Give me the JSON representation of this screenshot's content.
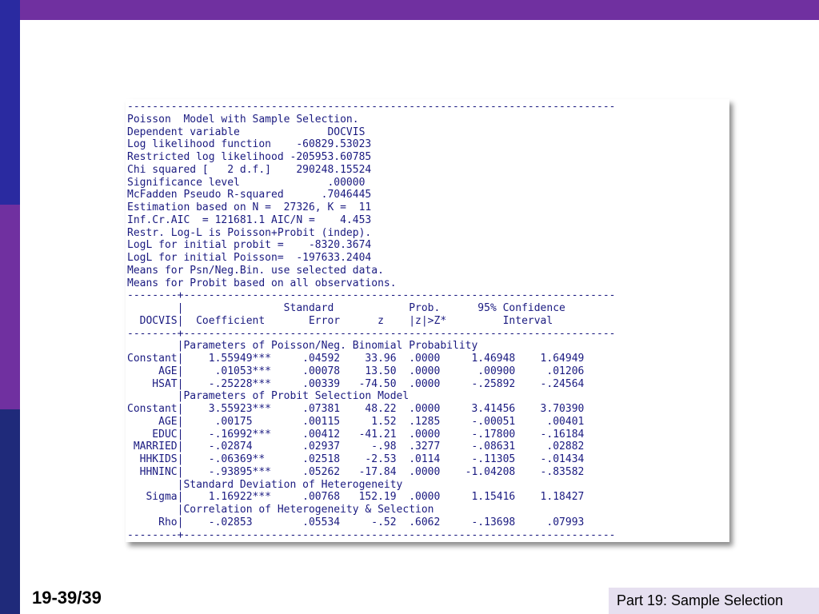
{
  "output": {
    "lines": [
      "------------------------------------------------------------------------------",
      "Poisson  Model with Sample Selection.",
      "Dependent variable              DOCVIS",
      "Log likelihood function    -60829.53023",
      "Restricted log likelihood -205953.60785",
      "Chi squared [   2 d.f.]    290248.15524",
      "Significance level              .00000",
      "McFadden Pseudo R-squared      .7046445",
      "Estimation based on N =  27326, K =  11",
      "Inf.Cr.AIC  = 121681.1 AIC/N =    4.453",
      "Restr. Log-L is Poisson+Probit (indep).",
      "LogL for initial probit =    -8320.3674",
      "LogL for initial Poisson=  -197633.2404",
      "Means for Psn/Neg.Bin. use selected data.",
      "Means for Probit based on all observations.",
      "--------+---------------------------------------------------------------------",
      "        |                Standard            Prob.      95% Confidence",
      "  DOCVIS|  Coefficient       Error      z    |z|>Z*         Interval",
      "--------+---------------------------------------------------------------------",
      "        |Parameters of Poisson/Neg. Binomial Probability",
      "Constant|    1.55949***     .04592    33.96  .0000     1.46948    1.64949",
      "     AGE|     .01053***     .00078    13.50  .0000      .00900     .01206",
      "    HSAT|    -.25228***     .00339   -74.50  .0000     -.25892    -.24564",
      "        |Parameters of Probit Selection Model",
      "Constant|    3.55923***     .07381    48.22  .0000     3.41456    3.70390",
      "     AGE|     .00175        .00115     1.52  .1285     -.00051     .00401",
      "    EDUC|    -.16992***     .00412   -41.21  .0000     -.17800    -.16184",
      " MARRIED|    -.02874        .02937     -.98  .3277     -.08631     .02882",
      "  HHKIDS|    -.06369**      .02518    -2.53  .0114     -.11305    -.01434",
      "  HHNINC|    -.93895***     .05262   -17.84  .0000    -1.04208    -.83582",
      "        |Standard Deviation of Heterogeneity",
      "   Sigma|    1.16922***     .00768   152.19  .0000     1.15416    1.18427",
      "        |Correlation of Heterogeneity & Selection",
      "     Rho|    -.02853        .05534     -.52  .6062     -.13698     .07993",
      "--------+---------------------------------------------------------------------"
    ]
  },
  "footer": {
    "page_number": "19-39/39",
    "section_label": "Part 19: Sample Selection"
  },
  "colors": {
    "top_bar": "#7030a0",
    "left_bar_top": "#2a2aa0",
    "left_bar_mid": "#7030a0",
    "left_bar_bottom": "#1f2a7a",
    "output_text": "#1a1a80",
    "footer_label_bg": "#e6e0f0"
  }
}
